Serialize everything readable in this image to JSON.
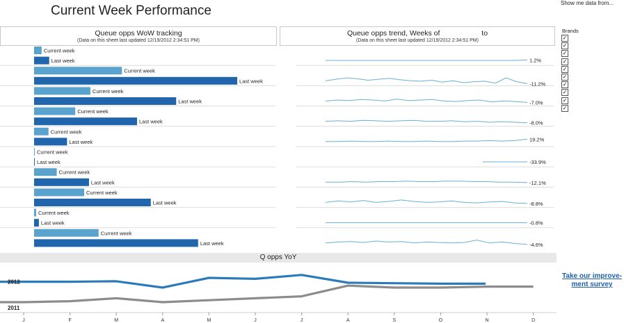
{
  "page_title": "Current Week Performance",
  "show_data_link": "Show me data from...",
  "brands": {
    "title": "Brands",
    "check_glyph": "✓",
    "checked": [
      true,
      true,
      true,
      true,
      true,
      true,
      true,
      true,
      true,
      true
    ]
  },
  "colors": {
    "current_week": "#5ba3cf",
    "last_week": "#2166ac",
    "trend_line": "#6aaed6",
    "yoy_2012": "#2b7bba",
    "yoy_2011": "#8c8c8c",
    "link": "#1f5fa8"
  },
  "survey_link": {
    "line1": "Take our improve-",
    "line2": "ment survey"
  },
  "chart_data": [
    {
      "type": "bar",
      "title": "Queue opps WoW tracking",
      "subtitle": "(Data on this sheet last updated 12/19/2012 2:34:51 PM)",
      "series": [
        {
          "name": "Current week",
          "values": [
            11,
            128,
            82,
            60,
            21,
            1,
            33,
            73,
            3,
            94
          ]
        },
        {
          "name": "Last week",
          "values": [
            22,
            296,
            207,
            150,
            48,
            1,
            80,
            170,
            7,
            239
          ]
        }
      ],
      "xlim": [
        0,
        300
      ]
    },
    {
      "type": "line",
      "title": "Queue opps trend, Weeks of",
      "title_suffix": "to",
      "subtitle": "(Data on this sheet last updated 12/19/2012 2:34:51 PM)",
      "rows": [
        {
          "label": "1.2%",
          "values": [
            50,
            50,
            50,
            50,
            50,
            50,
            50,
            50,
            50,
            50,
            50,
            50,
            50,
            50,
            50,
            50,
            50,
            51
          ]
        },
        {
          "label": "-11.2%",
          "values": [
            50,
            53,
            56,
            54,
            51,
            53,
            55,
            52,
            50,
            49,
            51,
            47,
            50,
            46,
            48,
            49,
            45,
            56,
            48,
            44
          ]
        },
        {
          "label": "-7.0%",
          "values": [
            50,
            52,
            51,
            53,
            52,
            50,
            54,
            51,
            52,
            53,
            50,
            49,
            51,
            52,
            48,
            50,
            49,
            47
          ]
        },
        {
          "label": "-8.0%",
          "values": [
            50,
            51,
            50,
            52,
            51,
            50,
            51,
            52,
            50,
            50,
            51,
            49,
            50,
            48,
            49,
            48,
            47
          ]
        },
        {
          "label": "19.2%",
          "values": [
            50,
            50,
            51,
            50,
            50,
            51,
            50,
            50,
            51,
            50,
            50,
            51,
            51,
            52,
            51,
            52,
            55
          ]
        },
        {
          "label": "-33.9%",
          "values": [
            50,
            50,
            50
          ]
        },
        {
          "label": "-12.1%",
          "values": [
            50,
            50,
            51,
            50,
            51,
            51,
            52,
            51,
            51,
            52,
            52,
            51,
            51,
            50,
            50,
            49
          ]
        },
        {
          "label": "-8.8%",
          "values": [
            50,
            53,
            51,
            54,
            50,
            52,
            55,
            52,
            50,
            51,
            53,
            50,
            49,
            51,
            52,
            49,
            48
          ]
        },
        {
          "label": "-0.8%",
          "values": [
            50,
            50,
            50,
            50,
            50,
            50,
            50,
            50,
            50,
            50,
            50,
            50,
            50,
            50,
            50,
            50,
            50
          ]
        },
        {
          "label": "-4.6%",
          "values": [
            50,
            52,
            53,
            51,
            54,
            52,
            53,
            50,
            52,
            51,
            50,
            51,
            56,
            50,
            52,
            49,
            47
          ]
        }
      ]
    },
    {
      "type": "line",
      "title": "Q opps YoY",
      "x": [
        "J",
        "F",
        "M",
        "A",
        "M",
        "J",
        "J",
        "A",
        "S",
        "O",
        "N",
        "D"
      ],
      "series": [
        {
          "name": "2012",
          "values": [
            81,
            81,
            81.5,
            75,
            85,
            84,
            88,
            80,
            79.5,
            79,
            79,
            null
          ]
        },
        {
          "name": "2011",
          "values": [
            60,
            61,
            64,
            60,
            62,
            64,
            66,
            77,
            75,
            75,
            76,
            76
          ]
        }
      ],
      "ylim": [
        50,
        95
      ]
    }
  ]
}
